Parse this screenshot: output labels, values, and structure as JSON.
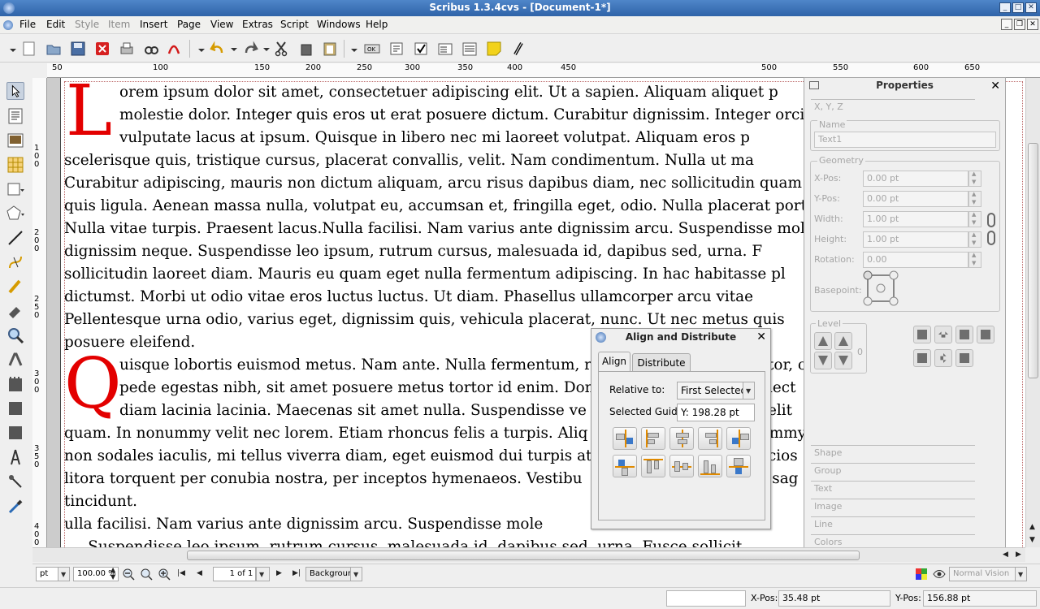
{
  "window": {
    "title": "Scribus 1.3.4cvs - [Document-1*]",
    "controls": [
      "_",
      "□",
      "✕"
    ]
  },
  "menubar": {
    "items": [
      {
        "label": "File",
        "enabled": true
      },
      {
        "label": "Edit",
        "enabled": true
      },
      {
        "label": "Style",
        "enabled": false
      },
      {
        "label": "Item",
        "enabled": false
      },
      {
        "label": "Insert",
        "enabled": true
      },
      {
        "label": "Page",
        "enabled": true
      },
      {
        "label": "View",
        "enabled": true
      },
      {
        "label": "Extras",
        "enabled": true
      },
      {
        "label": "Script",
        "enabled": true
      },
      {
        "label": "Windows",
        "enabled": true
      },
      {
        "label": "Help",
        "enabled": true
      }
    ],
    "mdi_controls": [
      "_",
      "❐",
      "✕"
    ]
  },
  "toolbar": {
    "icons": [
      "new-document-icon",
      "open-icon",
      "save-icon",
      "close-icon",
      "print-icon",
      "preflight-icon",
      "pdf-icon",
      "undo-icon",
      "redo-icon",
      "cut-icon",
      "copy-icon",
      "paste-icon",
      "pdf-pushbutton-icon",
      "pdf-textfield-icon",
      "pdf-checkbox-icon",
      "pdf-combobox-icon",
      "pdf-listbox-icon",
      "text-annotation-icon",
      "link-annotation-icon"
    ]
  },
  "rulers": {
    "horizontal": [
      "50",
      "100",
      "150",
      "200",
      "250",
      "300",
      "350",
      "400",
      "450",
      "500",
      "550",
      "600",
      "650"
    ],
    "vertical": [
      "100",
      "200",
      "250",
      "300",
      "350",
      "400"
    ]
  },
  "document": {
    "dropcap1": "L",
    "lines1": [
      "orem ipsum dolor sit amet, consectetuer adipiscing elit. Ut a sapien. Aliquam aliquet p",
      "molestie dolor. Integer quis eros ut erat posuere dictum. Curabitur dignissim. Integer orci. F",
      "vulputate lacus at ipsum. Quisque in libero nec mi laoreet volutpat. Aliquam eros p",
      "scelerisque quis, tristique cursus, placerat convallis, velit. Nam condimentum. Nulla ut ma",
      "Curabitur adipiscing, mauris non dictum aliquam, arcu risus dapibus diam, nec sollicitudin quam",
      "quis ligula. Aenean massa nulla, volutpat eu, accumsan et, fringilla eget, odio. Nulla placerat porta ju",
      "Nulla vitae turpis. Praesent lacus.Nulla facilisi. Nam varius ante dignissim arcu. Suspendisse mole",
      "dignissim neque. Suspendisse leo ipsum, rutrum cursus, malesuada id, dapibus sed, urna. F",
      "sollicitudin laoreet diam. Mauris eu quam eget nulla fermentum adipiscing. In hac habitasse pl",
      "dictumst. Morbi ut odio vitae eros luctus luctus. Ut diam. Phasellus ullamcorper arcu vitae",
      "Pellentesque urna odio, varius eget, dignissim quis, vehicula placerat, nunc. Ut nec metus quis",
      "posuere eleifend."
    ],
    "dropcap2": "Q",
    "lines2": [
      "uisque lobortis euismod metus. Nam ante. Nulla fermentum, r",
      "pede egestas nibh, sit amet posuere metus tortor id enim. Done",
      "diam lacinia lacinia. Maecenas sit amet nulla. Suspendisse ve",
      "quam. In nonummy velit nec lorem. Etiam rhoncus felis a turpis. Aliq",
      "non sodales iaculis, mi tellus viverra diam, eget euismod dui turpis at n",
      "litora torquent per conubia nostra, per inceptos hymenaeos. Vestibu",
      "tincidunt.",
      "ulla facilisi. Nam varius ante dignissim arcu. Suspendisse mole",
      "     Suspendisse leo ipsum, rutrum cursus, malesuada id, dapibus sed, urna. Fusce sollicit"
    ],
    "right_fragments": [
      {
        "text": "tor, c",
        "line": 0
      },
      {
        "text": "lect",
        "line": 1
      },
      {
        "text": "elit",
        "line": 2
      },
      {
        "text": "ummy",
        "line": 3
      },
      {
        "text": "cios",
        "line": 4
      },
      {
        "text": "s sag",
        "line": 5
      }
    ]
  },
  "properties": {
    "title": "Properties",
    "section_xyz": "X, Y, Z",
    "name_label": "Name",
    "name_value": "Text1",
    "geometry_label": "Geometry",
    "xpos_label": "X-Pos:",
    "xpos_value": "0.00 pt",
    "ypos_label": "Y-Pos:",
    "ypos_value": "0.00 pt",
    "width_label": "Width:",
    "width_value": "1.00 pt",
    "height_label": "Height:",
    "height_value": "1.00 pt",
    "rotation_label": "Rotation:",
    "rotation_value": "0.00",
    "basepoint_label": "Basepoint:",
    "level_label": "Level",
    "level_value": "0",
    "sections": [
      "Shape",
      "Group",
      "Text",
      "Image",
      "Line",
      "Colors"
    ]
  },
  "align_dialog": {
    "title": "Align and Distribute",
    "tabs": [
      "Align",
      "Distribute"
    ],
    "active_tab": "Align",
    "relative_label": "Relative to:",
    "relative_value": "First Selected",
    "guide_label": "Selected Guide:",
    "guide_value": "Y: 198.28 pt"
  },
  "viewbar": {
    "unit": "pt",
    "zoom": "100.00 %",
    "page": "1 of 1",
    "layer": "Background",
    "vision": "Normal Vision"
  },
  "statusbar": {
    "xpos_label": "X-Pos:",
    "xpos_value": "35.48 pt",
    "ypos_label": "Y-Pos:",
    "ypos_value": "156.88 pt"
  }
}
